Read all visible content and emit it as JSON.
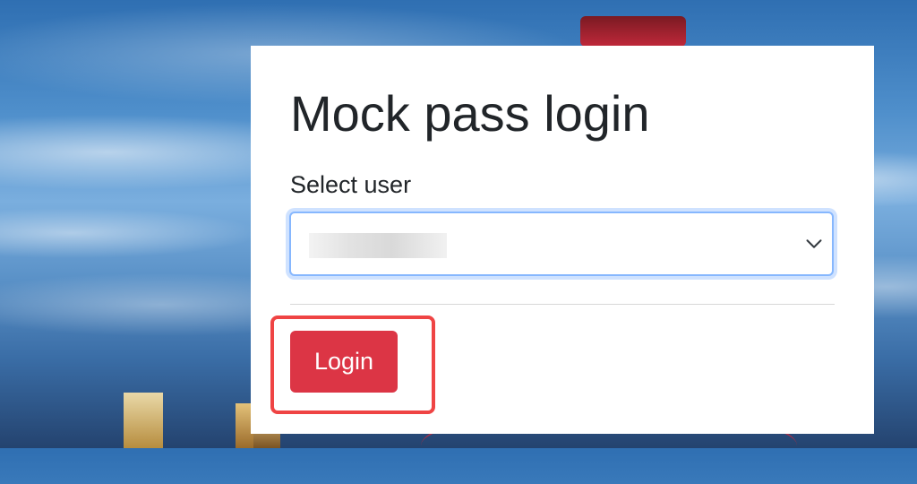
{
  "form": {
    "title": "Mock pass login",
    "select_label": "Select user",
    "selected_user": "",
    "login_label": "Login"
  },
  "icons": {
    "select_arrow": "chevron-down-icon"
  },
  "colors": {
    "login_button": "#dc3545",
    "focus_ring": "#86b7fe",
    "annotation_box": "#ef4444"
  }
}
